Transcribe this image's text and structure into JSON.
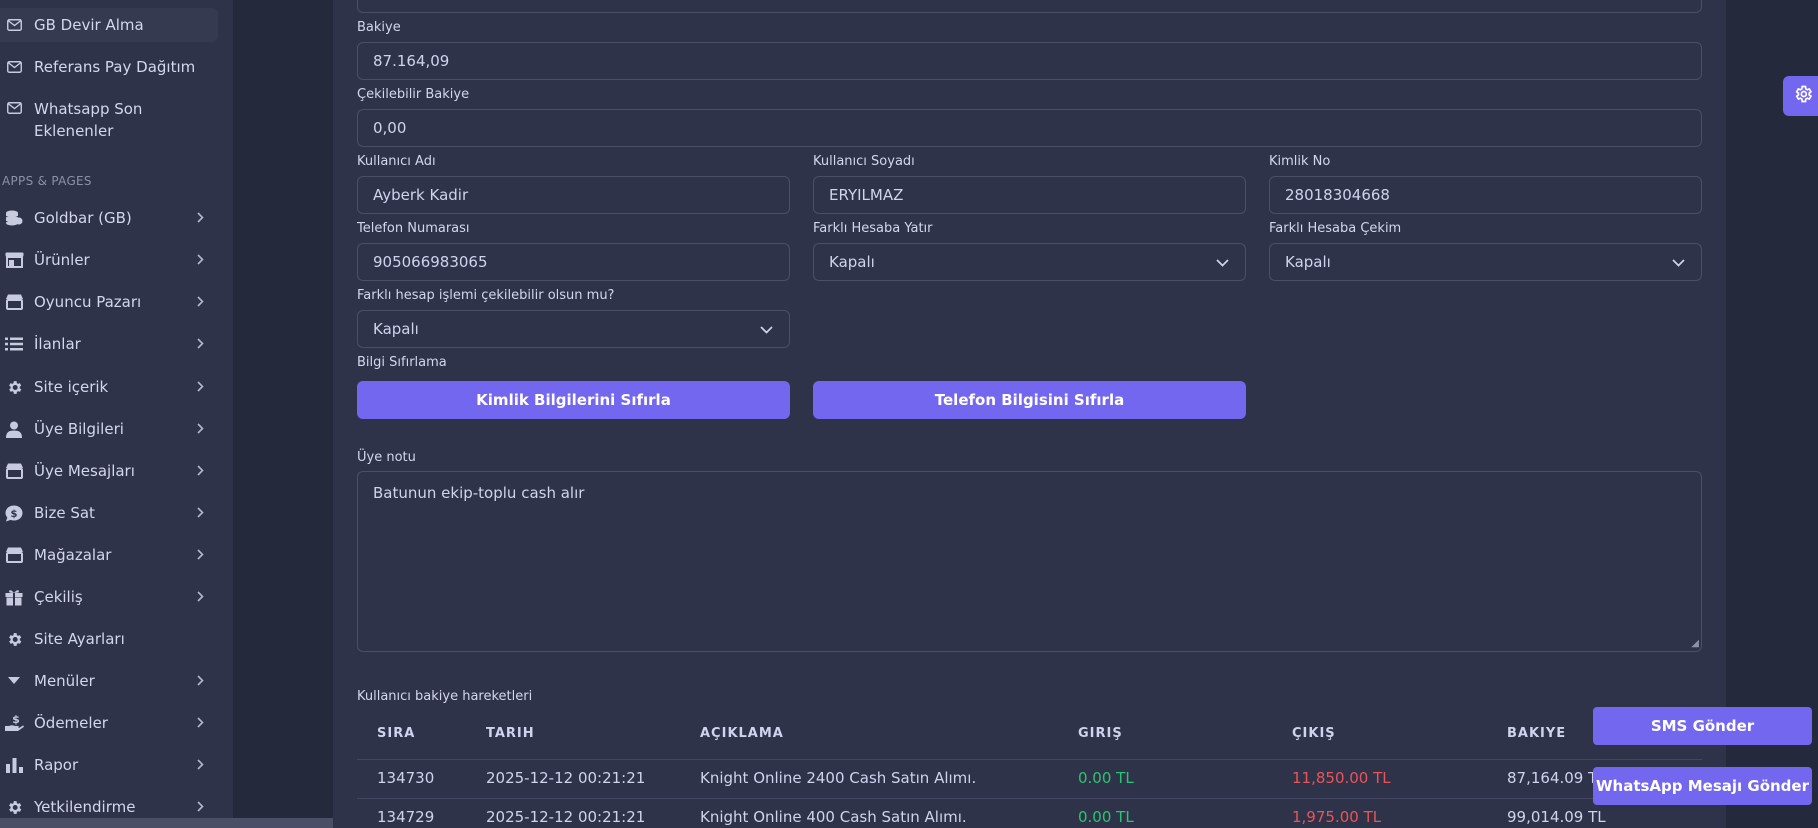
{
  "sidebar": {
    "top_items": [
      {
        "label": "GB Devir Alma",
        "icon": "mail-icon"
      },
      {
        "label": "Referans Pay Dağıtım",
        "icon": "mail-icon"
      },
      {
        "label": "Whatsapp Son Eklenenler",
        "icon": "mail-icon"
      }
    ],
    "section_title": "APPS & PAGES",
    "items": [
      {
        "label": "Goldbar (GB)",
        "icon": "coins-icon"
      },
      {
        "label": "Ürünler",
        "icon": "store-icon"
      },
      {
        "label": "Oyuncu Pazarı",
        "icon": "store-icon"
      },
      {
        "label": "İlanlar",
        "icon": "list-icon"
      },
      {
        "label": "Site içerik",
        "icon": "gear-icon"
      },
      {
        "label": "Üye Bilgileri",
        "icon": "user-icon"
      },
      {
        "label": "Üye Mesajları",
        "icon": "store-icon"
      },
      {
        "label": "Bize Sat",
        "icon": "dollar-bubble-icon"
      },
      {
        "label": "Mağazalar",
        "icon": "store-icon"
      },
      {
        "label": "Çekiliş",
        "icon": "gift-icon"
      },
      {
        "label": "Site Ayarları",
        "icon": "gear-icon"
      },
      {
        "label": "Menüler",
        "icon": "caret-down-icon"
      },
      {
        "label": "Ödemeler",
        "icon": "hand-money-icon"
      },
      {
        "label": "Rapor",
        "icon": "bar-chart-icon"
      },
      {
        "label": "Yetkilendirme",
        "icon": "gear-icon"
      }
    ]
  },
  "form": {
    "balance_label": "Bakiye",
    "balance_value": "87.164,09",
    "withdrawable_label": "Çekilebilir Bakiye",
    "withdrawable_value": "0,00",
    "first_name_label": "Kullanıcı Adı",
    "first_name_value": "Ayberk Kadir",
    "last_name_label": "Kullanıcı Soyadı",
    "last_name_value": "ERYILMAZ",
    "id_label": "Kimlik No",
    "id_value": "28018304668",
    "phone_label": "Telefon Numarası",
    "phone_value": "905066983065",
    "deposit_label": "Farklı Hesaba Yatır",
    "deposit_value": "Kapalı",
    "withdraw_label": "Farklı Hesaba Çekim",
    "withdraw_value": "Kapalı",
    "other_withdrawable_label": "Farklı hesap işlemi çekilebilir olsun mu?",
    "other_withdrawable_value": "Kapalı",
    "reset_label": "Bilgi Sıfırlama",
    "reset_identity_button": "Kimlik Bilgilerini Sıfırla",
    "reset_phone_button": "Telefon Bilgisini Sıfırla",
    "note_label": "Üye notu",
    "note_value": "Batunun ekip-toplu cash alır"
  },
  "table": {
    "title": "Kullanıcı bakiye hareketleri",
    "headers": [
      "SIRA",
      "TARIH",
      "AÇIKLAMA",
      "GIRIŞ",
      "ÇIKIŞ",
      "BAKIYE"
    ],
    "rows": [
      [
        "134730",
        "2025-12-12 00:21:21",
        "Knight Online 2400 Cash Satın Alımı.",
        "0.00 TL",
        "11,850.00 TL",
        "87,164.09 TL"
      ],
      [
        "134729",
        "2025-12-12 00:21:21",
        "Knight Online 400 Cash Satın Alımı.",
        "0.00 TL",
        "1,975.00 TL",
        "99,014.09 TL"
      ]
    ]
  },
  "floating": {
    "sms_button": "SMS Gönder",
    "whatsapp_button": "WhatsApp Mesajı Gönder"
  },
  "colors": {
    "accent": "#7367f0",
    "background": "#25293c",
    "card": "#2f3349",
    "success": "#28c76f",
    "danger": "#ea5455"
  }
}
